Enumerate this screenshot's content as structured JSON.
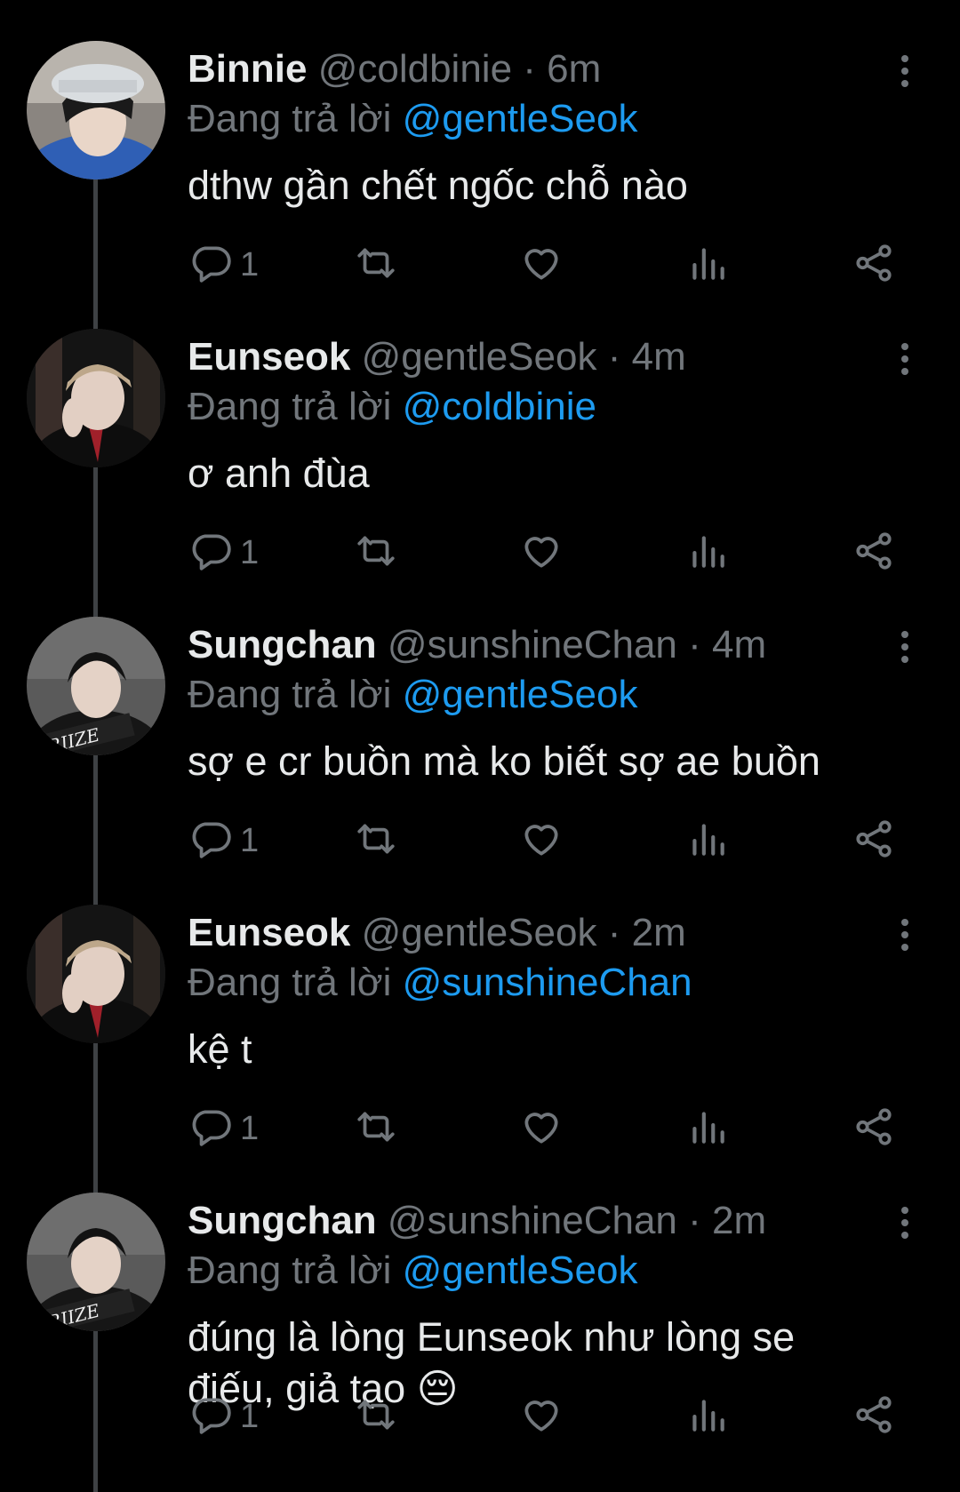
{
  "reply_prefix": "Đang trả lời",
  "colors": {
    "background": "#000000",
    "text": "#e7e9ea",
    "muted": "#71767b",
    "accent": "#1d9bf0"
  },
  "tweets": [
    {
      "name": "Binnie",
      "handle": "@coldbinie",
      "separator": "·",
      "time": "6m",
      "replying_to": "@gentleSeok",
      "text": "dthw gần chết ngốc chỗ nào",
      "reply_count": "1",
      "avatar_icon": "avatar-binnie"
    },
    {
      "name": "Eunseok",
      "handle": "@gentleSeok",
      "separator": "·",
      "time": "4m",
      "replying_to": "@coldbinie",
      "text": "ơ anh đùa",
      "reply_count": "1",
      "avatar_icon": "avatar-eunseok"
    },
    {
      "name": "Sungchan",
      "handle": "@sunshineChan",
      "separator": "·",
      "time": "4m",
      "replying_to": "@gentleSeok",
      "text": "sợ e cr buồn mà ko biết sợ ae buồn",
      "reply_count": "1",
      "avatar_icon": "avatar-sungchan"
    },
    {
      "name": "Eunseok",
      "handle": "@gentleSeok",
      "separator": "·",
      "time": "2m",
      "replying_to": "@sunshineChan",
      "text": "kệ t",
      "reply_count": "1",
      "avatar_icon": "avatar-eunseok"
    },
    {
      "name": "Sungchan",
      "handle": "@sunshineChan",
      "separator": "·",
      "time": "2m",
      "replying_to": "@gentleSeok",
      "text": "đúng là lòng Eunseok như lòng se điếu, giả tạo 😔",
      "reply_count": "1",
      "avatar_icon": "avatar-sungchan"
    }
  ]
}
